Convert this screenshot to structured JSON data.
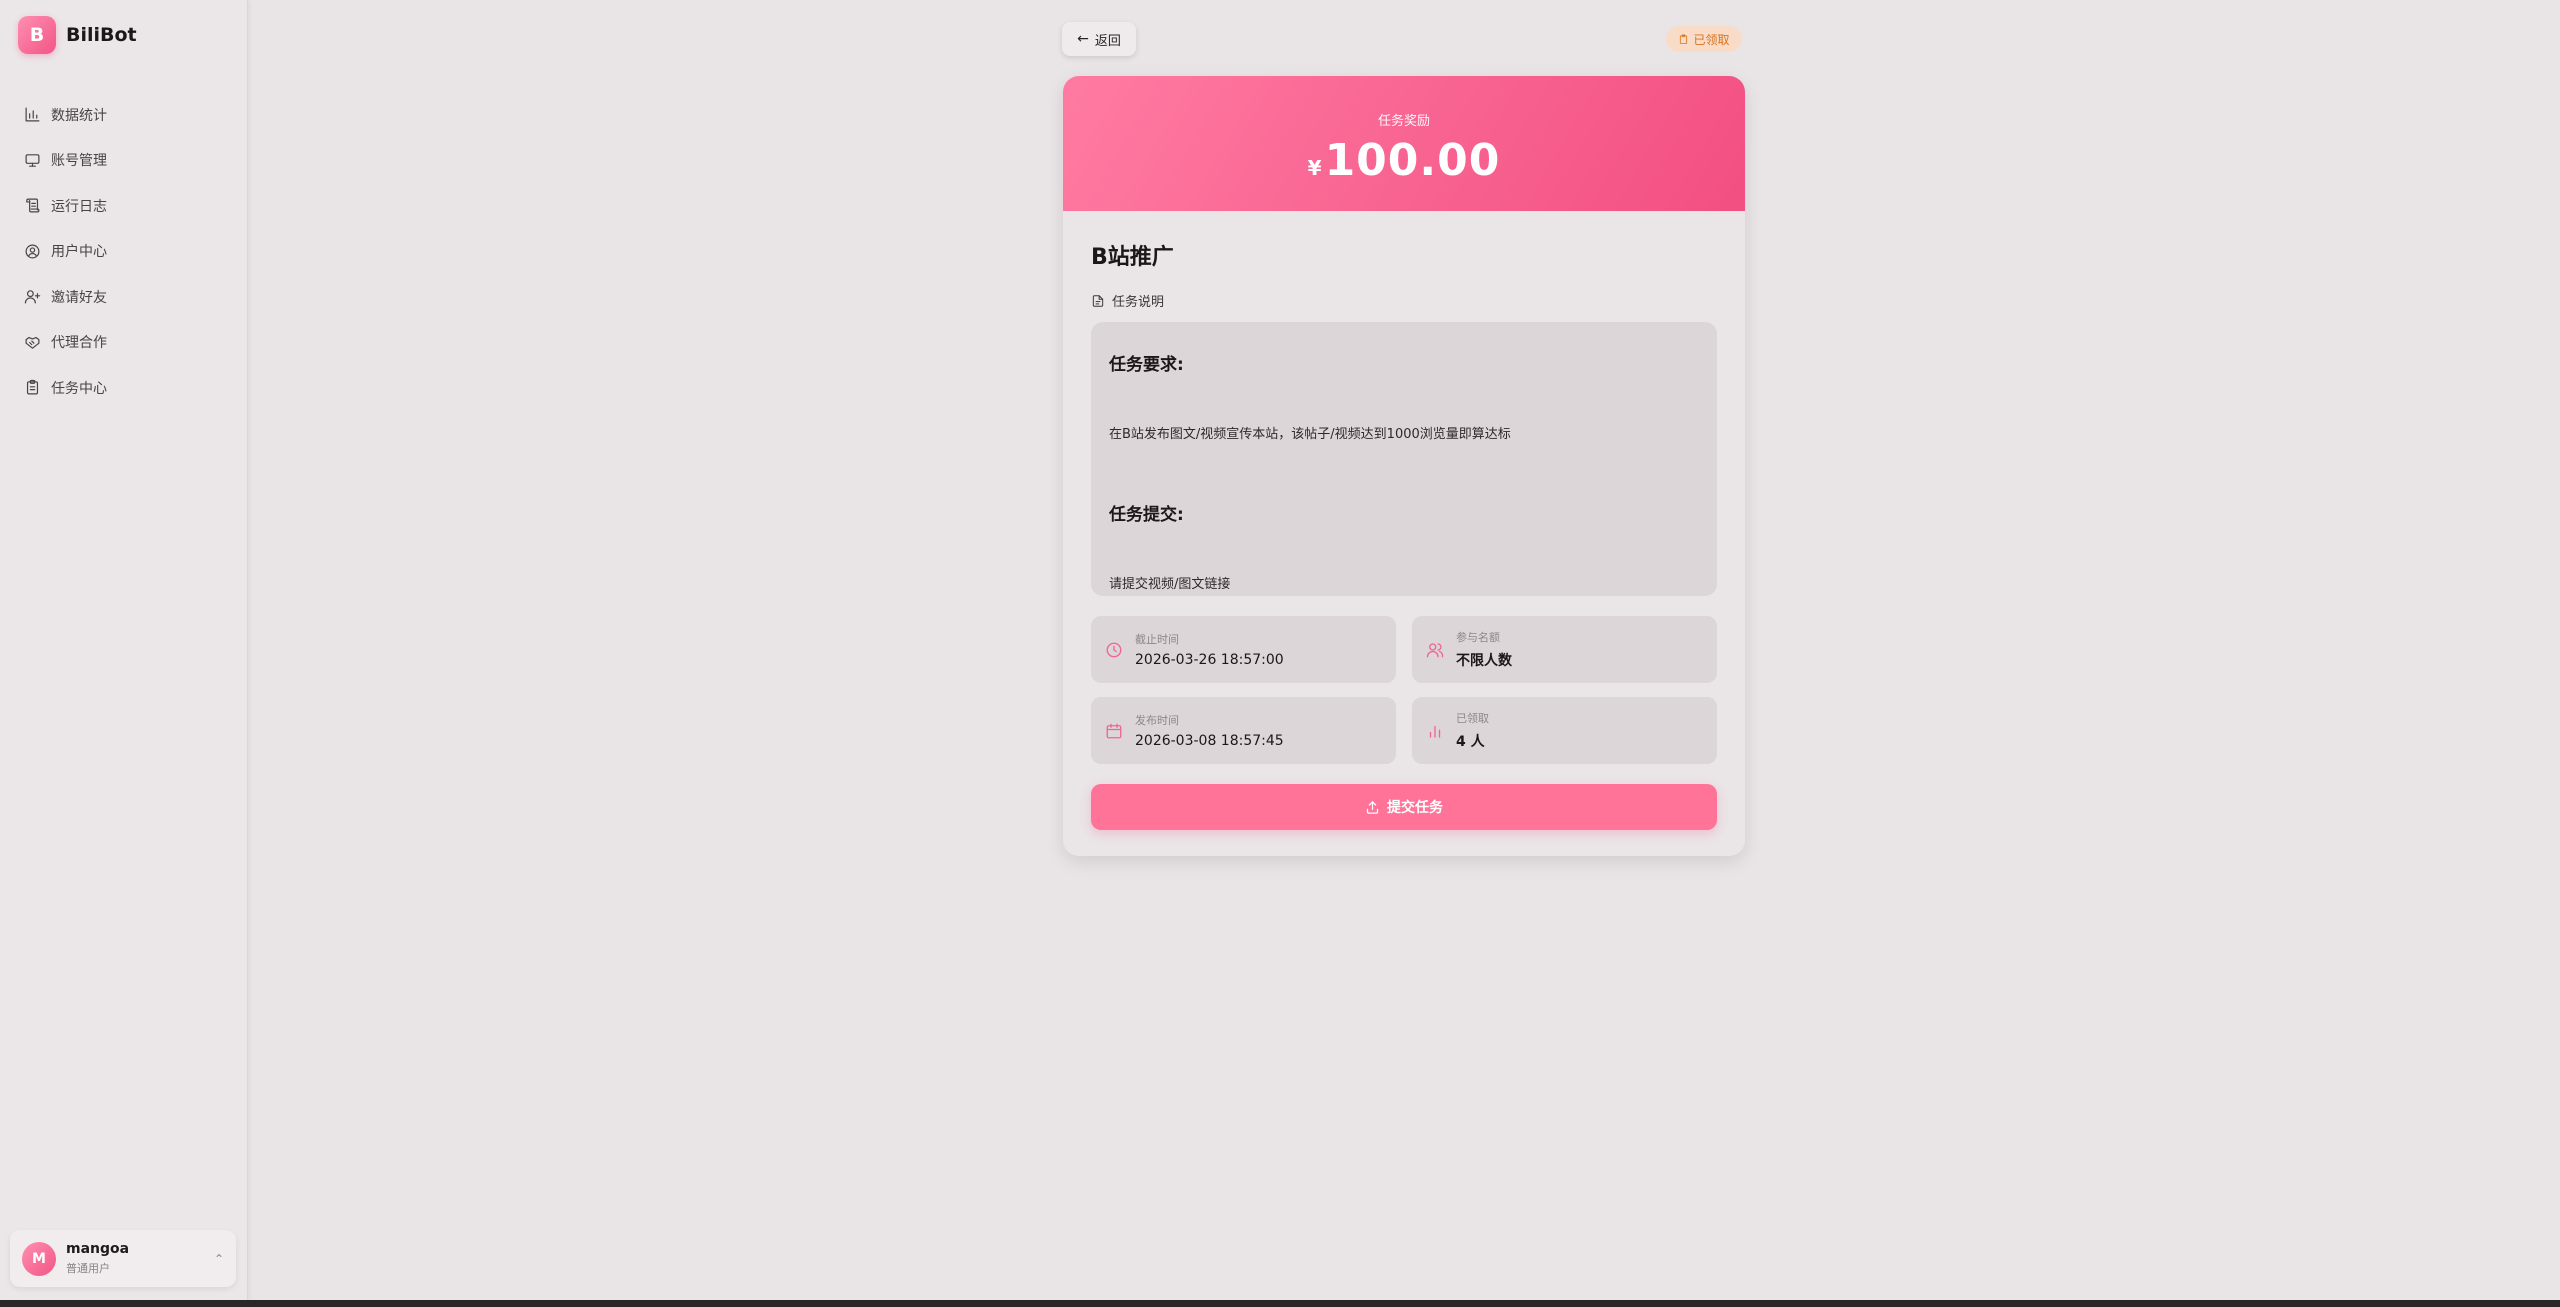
{
  "brand": {
    "logo_letter": "B",
    "name": "BiliBot"
  },
  "sidebar": {
    "items": [
      {
        "label": "数据统计",
        "icon": "bar-chart-icon"
      },
      {
        "label": "账号管理",
        "icon": "monitor-icon"
      },
      {
        "label": "运行日志",
        "icon": "scroll-icon"
      },
      {
        "label": "用户中心",
        "icon": "user-circle-icon"
      },
      {
        "label": "邀请好友",
        "icon": "user-plus-icon"
      },
      {
        "label": "代理合作",
        "icon": "handshake-icon"
      },
      {
        "label": "任务中心",
        "icon": "clipboard-icon"
      }
    ]
  },
  "user": {
    "avatar_letter": "M",
    "name": "mangoa",
    "role": "普通用户"
  },
  "topbar": {
    "back_label": "返回",
    "status_label": "已领取"
  },
  "task": {
    "reward_label": "任务奖励",
    "currency": "¥",
    "reward_amount": "100.00",
    "title": "B站推广",
    "desc_label": "任务说明",
    "requirement_heading": "任务要求:",
    "requirement_text": "在B站发布图文/视频宣传本站，该帖子/视频达到1000浏览量即算达标",
    "submit_heading": "任务提交:",
    "submit_text": "请提交视频/图文链接",
    "deadline_label": "截止时间",
    "deadline_value": "2026-03-26 18:57:00",
    "quota_label": "参与名额",
    "quota_value": "不限人数",
    "published_label": "发布时间",
    "published_value": "2026-03-08 18:57:45",
    "claimed_label": "已领取",
    "claimed_value": "4 人",
    "submit_button": "提交任务"
  },
  "colors": {
    "accent": "#f25586",
    "badge_text": "#d9731e",
    "badge_bg": "#f8dcc8"
  }
}
